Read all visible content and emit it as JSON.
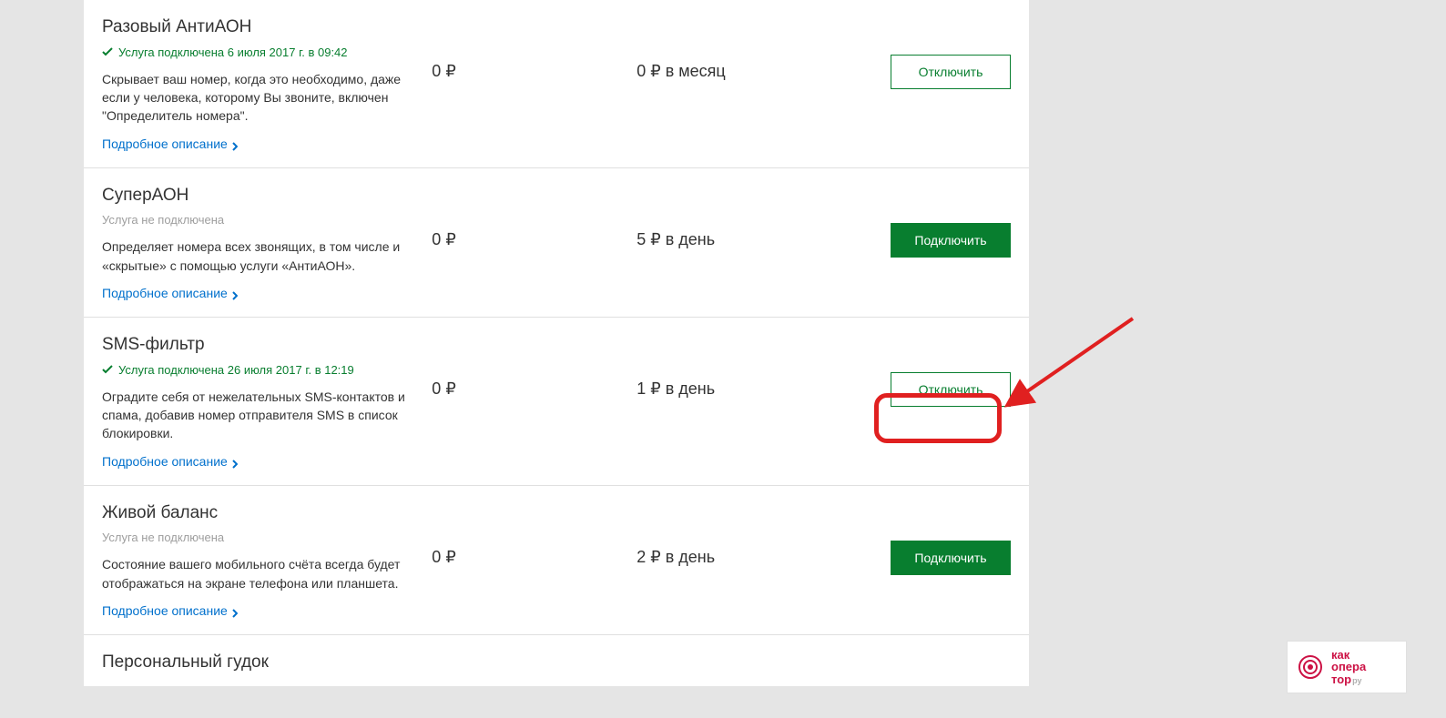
{
  "details_label": "Подробное описание",
  "currency_symbol": "₽",
  "services": [
    {
      "title": "Разовый АнтиАОН",
      "connected": true,
      "status_text": "Услуга подключена 6 июля 2017 г. в 09:42",
      "description": "Скрывает ваш номер, когда это необходимо, даже если у человека, которому Вы звоните, включен \"Определитель номера\".",
      "price": "0",
      "period_value": "0",
      "period_suffix": "в месяц",
      "action_label": "Отключить",
      "action_variant": "outline"
    },
    {
      "title": "СуперАОН",
      "connected": false,
      "status_text": "Услуга не подключена",
      "description": "Определяет номера всех звонящих, в том числе и «скрытые» с помощью услуги «АнтиАОН».",
      "price": "0",
      "period_value": "5",
      "period_suffix": "в день",
      "action_label": "Подключить",
      "action_variant": "solid"
    },
    {
      "title": "SMS-фильтр",
      "connected": true,
      "status_text": "Услуга подключена 26 июля 2017 г. в 12:19",
      "description": "Оградите себя от нежелательных SMS-контактов и спама, добавив номер отправителя SMS в список блокировки.",
      "price": "0",
      "period_value": "1",
      "period_suffix": "в день",
      "action_label": "Отключить",
      "action_variant": "outline"
    },
    {
      "title": "Живой баланс",
      "connected": false,
      "status_text": "Услуга не подключена",
      "description": "Состояние вашего мобильного счёта всегда будет отображаться на экране телефона или планшета.",
      "price": "0",
      "period_value": "2",
      "period_suffix": "в день",
      "action_label": "Подключить",
      "action_variant": "solid"
    },
    {
      "title": "Персональный гудок",
      "connected": null,
      "status_text": "",
      "description": "",
      "price": "",
      "period_value": "",
      "period_suffix": "",
      "action_label": "",
      "action_variant": ""
    }
  ],
  "logo": {
    "line1": "как",
    "line2": "опера",
    "line3": "тор",
    "suffix": "ру"
  }
}
